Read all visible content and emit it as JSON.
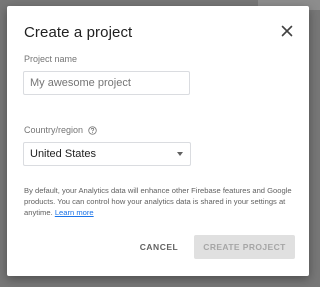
{
  "dialog": {
    "title": "Create a project",
    "close_icon": "close-icon"
  },
  "project_name": {
    "label": "Project name",
    "placeholder": "My awesome project",
    "value": ""
  },
  "country": {
    "label": "Country/region",
    "help_icon": "help-circle-icon",
    "selected": "United States"
  },
  "disclaimer": {
    "text": "By default, your Analytics data will enhance other Firebase features and Google products. You can control how your analytics data is shared in your settings at anytime. ",
    "link": "Learn more"
  },
  "actions": {
    "cancel_label": "CANCEL",
    "create_label": "CREATE PROJECT",
    "create_disabled": true
  },
  "colors": {
    "accent": "#1a73e8",
    "disabled_button_bg": "#e0e0e0",
    "overlay": "#777777"
  }
}
